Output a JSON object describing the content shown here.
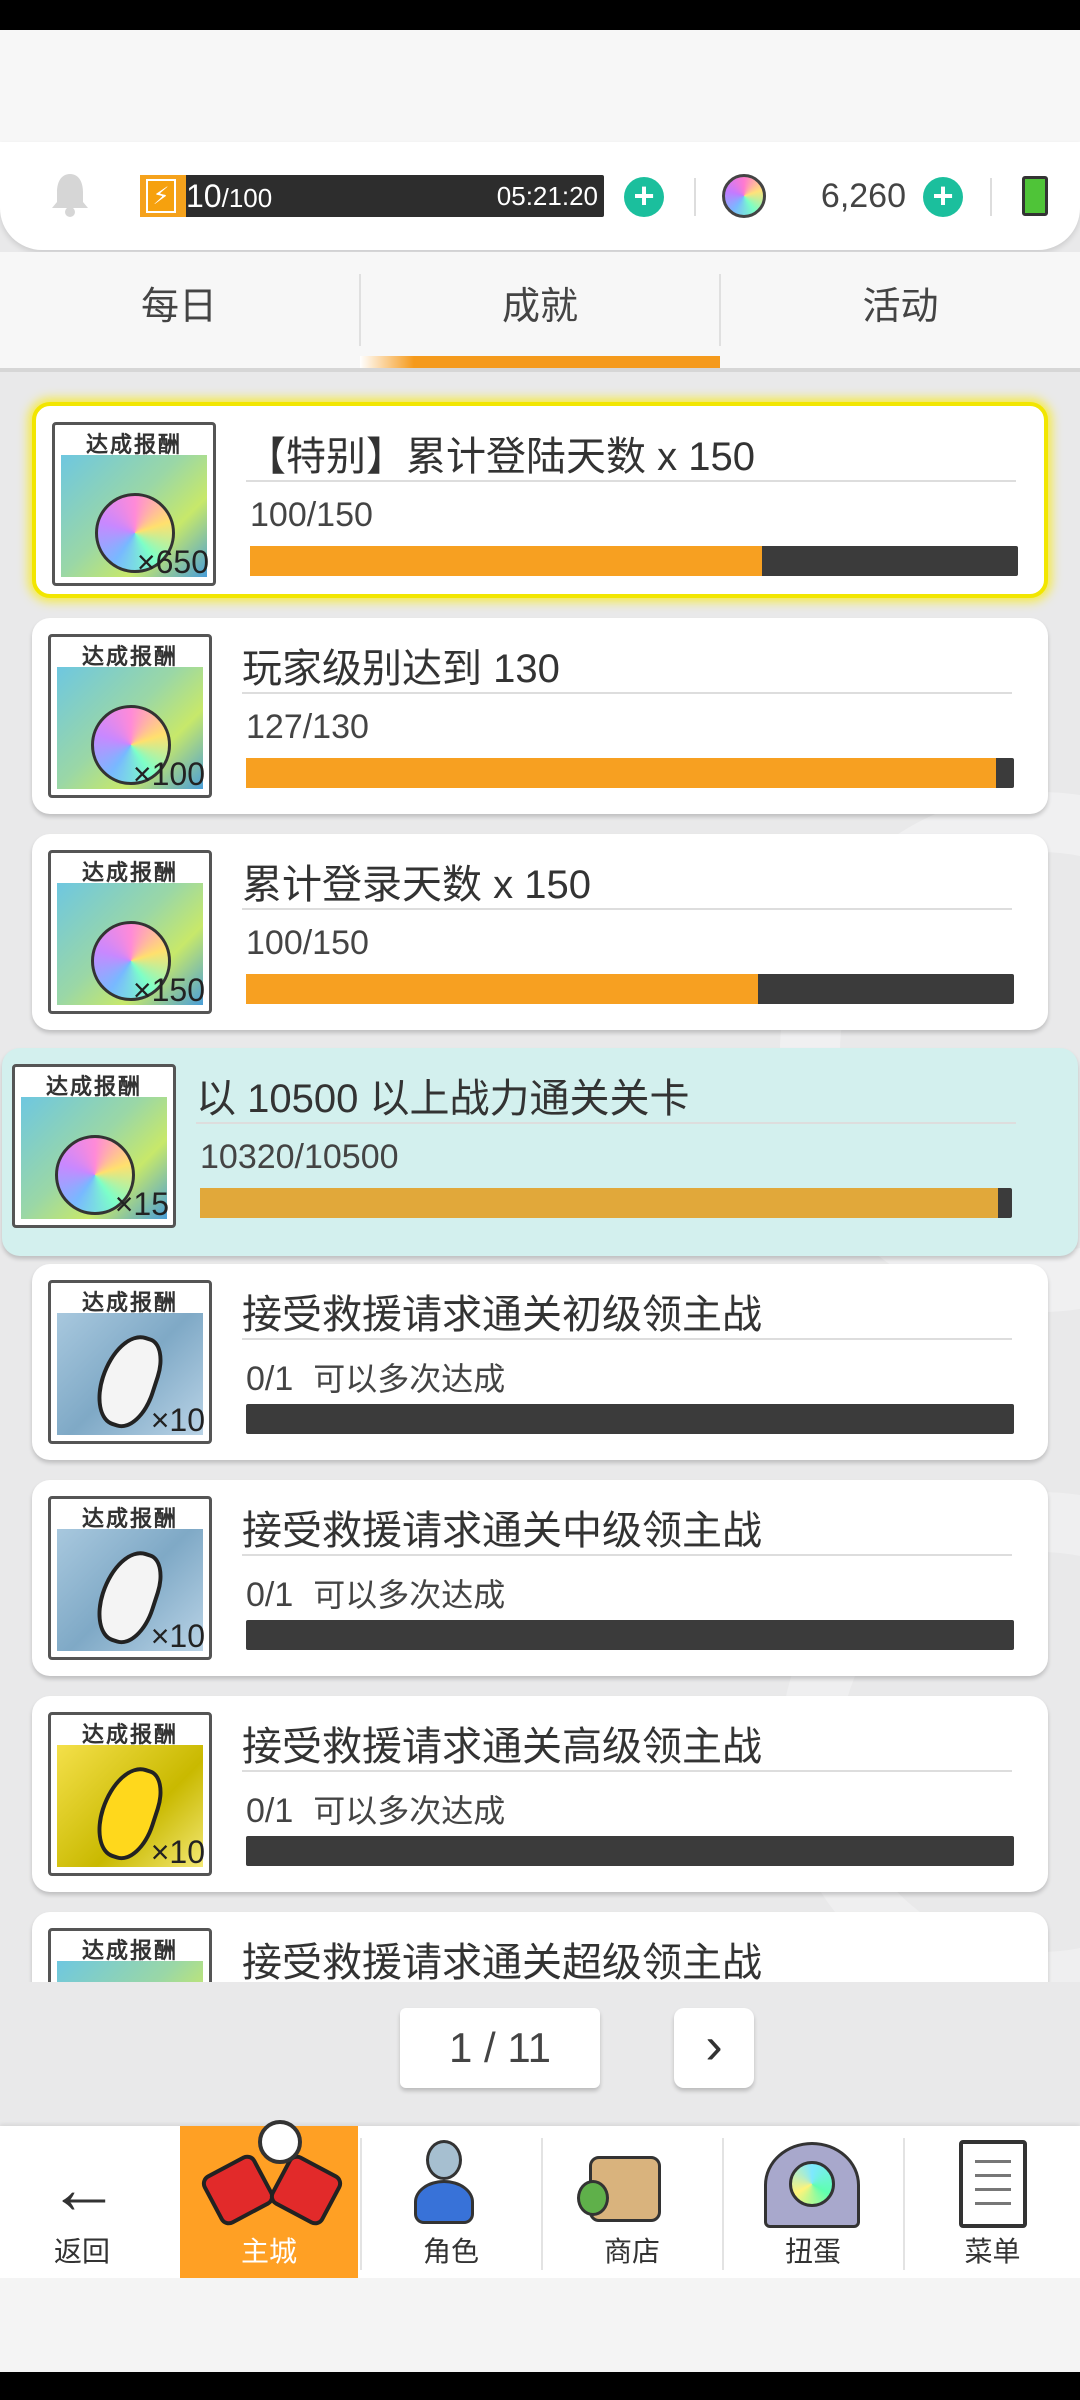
{
  "header": {
    "energy_current": "10",
    "energy_max": "/100",
    "energy_timer": "05:21:20",
    "energy_fraction": 0.1,
    "gem_count": "6,260"
  },
  "tabs": [
    {
      "label": "每日",
      "selected": false
    },
    {
      "label": "成就",
      "selected": true
    },
    {
      "label": "活动",
      "selected": false
    }
  ],
  "reward_label": "达成报酬",
  "achievements": [
    {
      "title": "【特别】累计登陆天数  x 150",
      "progress": "100/150",
      "extra": "",
      "fraction": 0.667,
      "reward_count": "×650",
      "reward_icon": "rainbow-gem-icon"
    },
    {
      "title": "玩家级别达到 130",
      "progress": "127/130",
      "extra": "",
      "fraction": 0.977,
      "reward_count": "×100",
      "reward_icon": "rainbow-gem-icon"
    },
    {
      "title": "累计登录天数  x 150",
      "progress": "100/150",
      "extra": "",
      "fraction": 0.667,
      "reward_count": "×150",
      "reward_icon": "rainbow-gem-icon"
    },
    {
      "title": "以 10500 以上战力通关关卡",
      "progress": "10320/10500",
      "extra": "",
      "fraction": 0.983,
      "reward_count": "×15",
      "reward_icon": "rainbow-gem-icon"
    },
    {
      "title": "接受救援请求通关初级领主战",
      "progress": "0/1",
      "extra": "可以多次达成",
      "fraction": 0,
      "reward_count": "×10",
      "reward_icon": "white-feather-icon"
    },
    {
      "title": "接受救援请求通关中级领主战",
      "progress": "0/1",
      "extra": "可以多次达成",
      "fraction": 0,
      "reward_count": "×10",
      "reward_icon": "white-feather-icon"
    },
    {
      "title": "接受救援请求通关高级领主战",
      "progress": "0/1",
      "extra": "可以多次达成",
      "fraction": 0,
      "reward_count": "×10",
      "reward_icon": "gold-feather-icon"
    },
    {
      "title": "接受救援请求通关超级领主战",
      "progress": "",
      "extra": "",
      "fraction": 0,
      "reward_count": "",
      "reward_icon": "rainbow-feather-icon"
    }
  ],
  "pagination": {
    "current": "1 / 11"
  },
  "nav": {
    "back": "返回",
    "main": "主城",
    "character": "角色",
    "shop": "商店",
    "gacha": "扭蛋",
    "menu": "菜单"
  },
  "colors": {
    "accent_orange": "#f7a021",
    "plus_green": "#1bbf9d",
    "active_card": "#d3f0ee",
    "gold_border": "#f2e600"
  }
}
